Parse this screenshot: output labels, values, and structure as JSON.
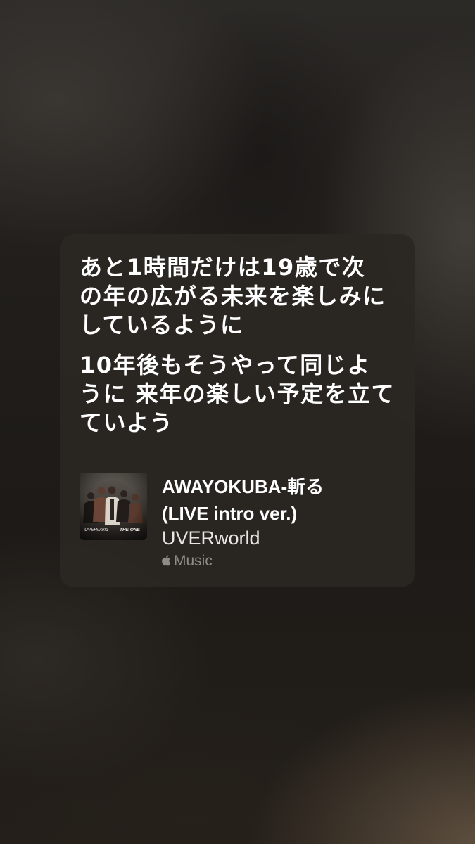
{
  "lyrics": {
    "paragraphs": [
      {
        "lines": [
          "あと1時間だけは19歳で次",
          "の年の広がる未来を楽しみに",
          "しているように"
        ]
      },
      {
        "lines": [
          "10年後もそうやって同じよ",
          "うに 来年の楽しい予定を立て",
          "ていよう"
        ]
      }
    ]
  },
  "song": {
    "title_lines": [
      "AWAYOKUBA-斬る",
      "(LIVE intro ver.)"
    ],
    "artist": "UVERworld",
    "service": "Music",
    "service_icon": "apple-logo-icon",
    "artwork": {
      "labels": [
        "UVERworld",
        "THE ONE"
      ]
    }
  },
  "colors": {
    "background": "#1e1b18",
    "card": "#2b2723",
    "lyric_text": "#ffffff",
    "artist_text": "#e9e7e4",
    "service_text": "#8f8b87"
  }
}
